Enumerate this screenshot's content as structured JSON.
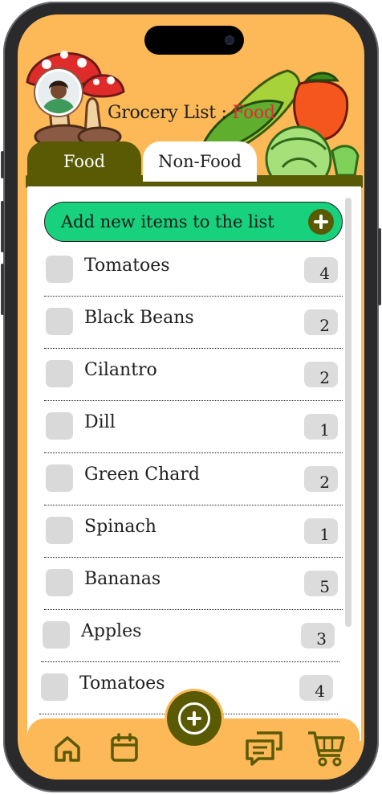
{
  "header": {
    "title_prefix": "Grocery List : ",
    "title_category": "Food"
  },
  "tabs": [
    {
      "label": "Food",
      "active": true
    },
    {
      "label": "Non-Food",
      "active": false
    }
  ],
  "add_button": {
    "label": "Add new items to the list",
    "icon": "plus-icon"
  },
  "items": [
    {
      "name": "Tomatoes",
      "qty": "4",
      "checked": false
    },
    {
      "name": "Black Beans",
      "qty": "2",
      "checked": false
    },
    {
      "name": "Cilantro",
      "qty": "2",
      "checked": false
    },
    {
      "name": "Dill",
      "qty": "1",
      "checked": false
    },
    {
      "name": "Green Chard",
      "qty": "2",
      "checked": false
    },
    {
      "name": "Spinach",
      "qty": "1",
      "checked": false
    },
    {
      "name": "Bananas",
      "qty": "5",
      "checked": false
    },
    {
      "name": "Apples",
      "qty": "3",
      "checked": false
    },
    {
      "name": "Tomatoes",
      "qty": "4",
      "checked": false
    }
  ],
  "nav": {
    "icons": [
      "home-icon",
      "calendar-icon",
      "add-icon",
      "chat-icon",
      "cart-icon"
    ]
  },
  "colors": {
    "background": "#fdb957",
    "accent_olive": "#5a5a04",
    "add_green": "#17d17d",
    "category_red": "#e8283a"
  }
}
